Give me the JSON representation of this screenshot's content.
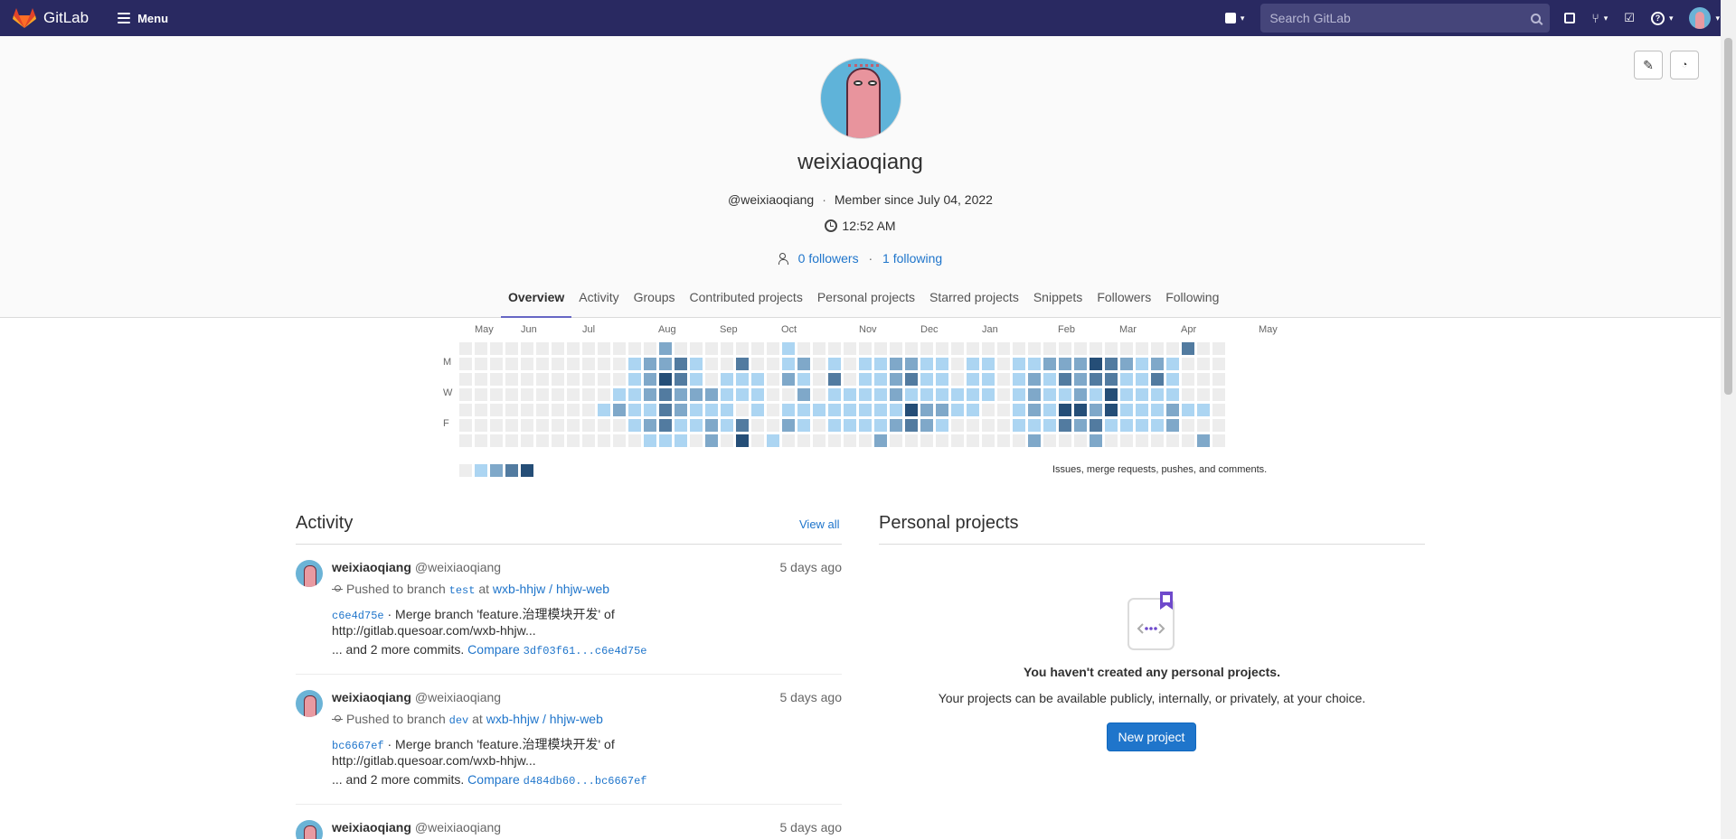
{
  "topbar": {
    "brand": "GitLab",
    "menu_label": "Menu",
    "search_placeholder": "Search GitLab"
  },
  "profile": {
    "name": "weixiaoqiang",
    "handle": "@weixiaoqiang",
    "member_since": "Member since July 04, 2022",
    "local_time": "12:52 AM",
    "followers": "0 followers",
    "following": "1 following"
  },
  "tabs": [
    "Overview",
    "Activity",
    "Groups",
    "Contributed projects",
    "Personal projects",
    "Starred projects",
    "Snippets",
    "Followers",
    "Following"
  ],
  "calendar": {
    "months": [
      "May",
      "Jun",
      "Jul",
      "Aug",
      "Sep",
      "Oct",
      "Nov",
      "Dec",
      "Jan",
      "Feb",
      "Mar",
      "Apr",
      "May"
    ],
    "day_labels": [
      "M",
      "W",
      "F"
    ],
    "caption": "Issues, merge requests, pushes, and comments.",
    "colors": [
      "#ededed",
      "#acd5f2",
      "#7fa8c9",
      "#527ba0",
      "#254e77"
    ],
    "weeks": [
      [
        0,
        0,
        0,
        0,
        0,
        0,
        0
      ],
      [
        0,
        0,
        0,
        0,
        0,
        0,
        0
      ],
      [
        0,
        0,
        0,
        0,
        0,
        0,
        0
      ],
      [
        0,
        0,
        0,
        0,
        0,
        0,
        0
      ],
      [
        0,
        0,
        0,
        0,
        0,
        0,
        0
      ],
      [
        0,
        0,
        0,
        0,
        0,
        0,
        0
      ],
      [
        0,
        0,
        0,
        0,
        0,
        0,
        0
      ],
      [
        0,
        0,
        0,
        0,
        0,
        0,
        0
      ],
      [
        0,
        0,
        0,
        0,
        0,
        0,
        0
      ],
      [
        0,
        0,
        0,
        0,
        1,
        0,
        0
      ],
      [
        0,
        0,
        0,
        1,
        2,
        0,
        0
      ],
      [
        0,
        1,
        1,
        1,
        1,
        1,
        0
      ],
      [
        0,
        2,
        2,
        2,
        1,
        2,
        1
      ],
      [
        2,
        2,
        4,
        3,
        3,
        3,
        1
      ],
      [
        0,
        3,
        3,
        2,
        2,
        1,
        1
      ],
      [
        0,
        1,
        1,
        2,
        1,
        1,
        0
      ],
      [
        0,
        0,
        0,
        2,
        1,
        2,
        2
      ],
      [
        0,
        0,
        1,
        1,
        1,
        1,
        0
      ],
      [
        0,
        3,
        1,
        1,
        0,
        3,
        4
      ],
      [
        0,
        0,
        1,
        1,
        1,
        0,
        0
      ],
      [
        0,
        0,
        0,
        0,
        0,
        0,
        1
      ],
      [
        1,
        1,
        2,
        0,
        1,
        2,
        0
      ],
      [
        0,
        2,
        1,
        2,
        1,
        1,
        0
      ],
      [
        0,
        0,
        0,
        0,
        1,
        0,
        0
      ],
      [
        0,
        1,
        3,
        1,
        1,
        1,
        0
      ],
      [
        0,
        0,
        0,
        1,
        1,
        1,
        0
      ],
      [
        0,
        1,
        1,
        1,
        1,
        1,
        0
      ],
      [
        0,
        1,
        1,
        1,
        1,
        1,
        2
      ],
      [
        0,
        2,
        2,
        2,
        1,
        2,
        0
      ],
      [
        0,
        2,
        3,
        1,
        4,
        3,
        0
      ],
      [
        0,
        1,
        1,
        1,
        2,
        2,
        0
      ],
      [
        0,
        1,
        1,
        1,
        2,
        1,
        0
      ],
      [
        0,
        0,
        0,
        1,
        1,
        0,
        0
      ],
      [
        0,
        1,
        1,
        1,
        1,
        0,
        0
      ],
      [
        0,
        1,
        1,
        1,
        0,
        0,
        0
      ],
      [
        0,
        0,
        0,
        0,
        0,
        0,
        0
      ],
      [
        0,
        1,
        1,
        1,
        1,
        1,
        0
      ],
      [
        0,
        1,
        2,
        2,
        2,
        1,
        2
      ],
      [
        0,
        2,
        1,
        1,
        1,
        1,
        0
      ],
      [
        0,
        2,
        3,
        1,
        4,
        3,
        0
      ],
      [
        0,
        2,
        2,
        2,
        4,
        2,
        0
      ],
      [
        0,
        4,
        3,
        1,
        2,
        3,
        2
      ],
      [
        0,
        3,
        3,
        4,
        4,
        1,
        0
      ],
      [
        0,
        2,
        1,
        1,
        1,
        1,
        0
      ],
      [
        0,
        1,
        1,
        1,
        1,
        1,
        0
      ],
      [
        0,
        2,
        3,
        1,
        1,
        1,
        0
      ],
      [
        0,
        1,
        1,
        1,
        2,
        2,
        0
      ],
      [
        3,
        0,
        0,
        0,
        1,
        0,
        0
      ],
      [
        0,
        0,
        0,
        0,
        1,
        0,
        2
      ],
      [
        0,
        0,
        0,
        0,
        0,
        0,
        0
      ]
    ]
  },
  "activity": {
    "title": "Activity",
    "view_all": "View all",
    "events": [
      {
        "author": "weixiaoqiang",
        "handle": "@weixiaoqiang",
        "time": "5 days ago",
        "action": "Pushed to branch",
        "branch": "test",
        "at": "at",
        "project": "wxb-hhjw / hhjw-web",
        "sha": "c6e4d75e",
        "message": "· Merge branch 'feature.治理模块开发' of",
        "message2": "http://gitlab.quesoar.com/wxb-hhjw...",
        "more": "... and 2 more commits.",
        "compare_label": "Compare",
        "compare_range": "3df03f61...c6e4d75e"
      },
      {
        "author": "weixiaoqiang",
        "handle": "@weixiaoqiang",
        "time": "5 days ago",
        "action": "Pushed to branch",
        "branch": "dev",
        "at": "at",
        "project": "wxb-hhjw / hhjw-web",
        "sha": "bc6667ef",
        "message": "· Merge branch 'feature.治理模块开发' of",
        "message2": "http://gitlab.quesoar.com/wxb-hhjw...",
        "more": "... and 2 more commits.",
        "compare_label": "Compare",
        "compare_range": "d484db60...bc6667ef"
      },
      {
        "author": "weixiaoqiang",
        "handle": "@weixiaoqiang",
        "time": "5 days ago"
      }
    ]
  },
  "projects": {
    "title": "Personal projects",
    "empty_title": "You haven't created any personal projects.",
    "empty_text": "Your projects can be available publicly, internally, or privately, at your choice.",
    "new_project": "New project"
  }
}
